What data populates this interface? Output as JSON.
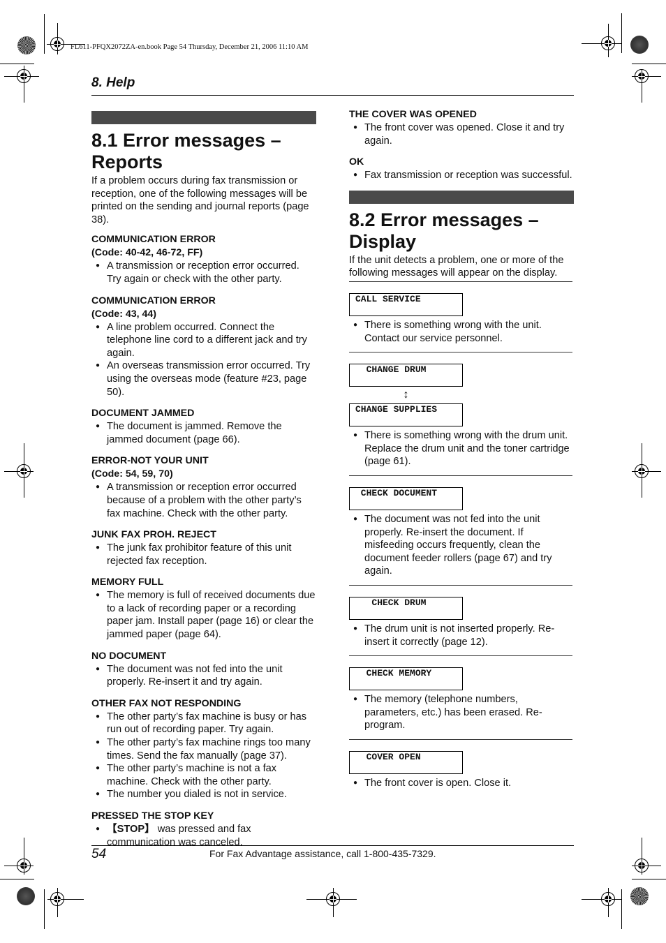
{
  "print_info": "FL611-PFQX2072ZA-en.book  Page 54  Thursday, December 21, 2006  11:10 AM",
  "header": {
    "chapter": "8. Help"
  },
  "section1": {
    "title_line1": "8.1 Error messages –",
    "title_line2": "Reports",
    "intro": "If a problem occurs during fax transmission or reception, one of the following messages will be printed on the sending and journal reports (page 38).",
    "entries": [
      {
        "title": "COMMUNICATION ERROR",
        "code": "(Code: 40-42, 46-72, FF)",
        "bullets": [
          "A transmission or reception error occurred. Try again or check with the other party."
        ]
      },
      {
        "title": "COMMUNICATION ERROR",
        "code": "(Code: 43, 44)",
        "bullets": [
          "A line problem occurred. Connect the telephone line cord to a different jack and try again.",
          "An overseas transmission error occurred. Try using the overseas mode (feature #23, page 50)."
        ]
      },
      {
        "title": "DOCUMENT JAMMED",
        "bullets": [
          "The document is jammed. Remove the jammed document (page 66)."
        ]
      },
      {
        "title": "ERROR-NOT YOUR UNIT",
        "code": "(Code: 54, 59, 70)",
        "bullets": [
          "A transmission or reception error occurred because of a problem with the other party’s fax machine. Check with the other party."
        ]
      },
      {
        "title": "JUNK FAX PROH. REJECT",
        "bullets": [
          "The junk fax prohibitor feature of this unit rejected fax reception."
        ]
      },
      {
        "title": "MEMORY FULL",
        "bullets": [
          "The memory is full of received documents due to a lack of recording paper or a recording paper jam. Install paper (page 16) or clear the jammed paper (page 64)."
        ]
      },
      {
        "title": "NO DOCUMENT",
        "bullets": [
          "The document was not fed into the unit properly. Re-insert it and try again."
        ]
      },
      {
        "title": "OTHER FAX NOT RESPONDING",
        "bullets": [
          "The other party’s fax machine is busy or has run out of recording paper. Try again.",
          "The other party’s fax machine rings too many times. Send the fax manually (page 37).",
          "The other party’s machine is not a fax machine. Check with the other party.",
          "The number you dialed is not in service."
        ]
      },
      {
        "title": "PRESSED THE STOP KEY",
        "stop_key": "【STOP】",
        "bullets": [
          "was pressed and fax communication was canceled."
        ]
      },
      {
        "title": "THE COVER WAS OPENED",
        "bullets": [
          "The front cover was opened. Close it and try again."
        ]
      },
      {
        "title": "OK",
        "bullets": [
          "Fax transmission or reception was successful."
        ]
      }
    ]
  },
  "section2": {
    "title_line1": "8.2 Error messages –",
    "title_line2": "Display",
    "intro": "If the unit detects a problem, one or more of the following messages will appear on the display.",
    "entries": [
      {
        "display": "CALL SERVICE",
        "bullets": [
          "There is something wrong with the unit. Contact our service personnel."
        ]
      },
      {
        "display": "  CHANGE DRUM",
        "display_alt": "CHANGE SUPPLIES",
        "alternates_icon": "up-down-arrow",
        "bullets": [
          "There is something wrong with the drum unit. Replace the drum unit and the toner cartridge (page 61)."
        ]
      },
      {
        "display": " CHECK DOCUMENT",
        "bullets": [
          "The document was not fed into the unit properly. Re-insert the document. If misfeeding occurs frequently, clean the document feeder rollers (page 67) and try again."
        ]
      },
      {
        "display": "   CHECK DRUM",
        "bullets": [
          "The drum unit is not inserted properly. Re-insert it correctly (page 12)."
        ]
      },
      {
        "display": "  CHECK MEMORY",
        "bullets": [
          "The memory (telephone numbers, parameters, etc.) has been erased. Re-program."
        ]
      },
      {
        "display": "  COVER OPEN",
        "bullets": [
          "The front cover is open. Close it."
        ]
      }
    ]
  },
  "footer": {
    "page_number": "54",
    "assistance": "For Fax Advantage assistance, call 1-800-435-7329."
  }
}
